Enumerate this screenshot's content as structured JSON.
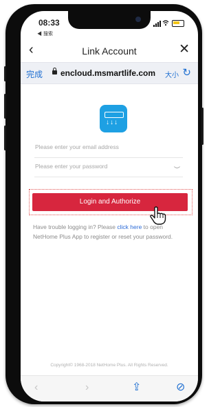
{
  "status": {
    "time": "08:33",
    "back_to_app": "◀ 搜索"
  },
  "nav": {
    "title": "Link Account",
    "back_icon": "‹",
    "close_icon": "✕"
  },
  "url_bar": {
    "done_label": "完成",
    "url": "encloud.msmartlife.com",
    "text_size_label": "大小",
    "refresh_icon": "↻"
  },
  "form": {
    "email_placeholder": "Please enter your email address",
    "password_placeholder": "Please enter your password",
    "login_button": "Login and Authorize"
  },
  "help": {
    "prefix": "Have trouble logging in? Please ",
    "link_text": "click here",
    "suffix": " to open NetHome Plus App to register or reset your password."
  },
  "footer": {
    "copyright": "Copyright© 1968-2018 NetHome Plus. All Rights Reserved."
  },
  "browser_toolbar": {
    "back_icon": "‹",
    "forward_icon": "›",
    "share_icon": "⇪",
    "safari_icon": "⊘"
  },
  "colors": {
    "accent_red": "#d7263e",
    "link_blue": "#1f6fd1",
    "app_icon_blue": "#1ea0e3"
  }
}
